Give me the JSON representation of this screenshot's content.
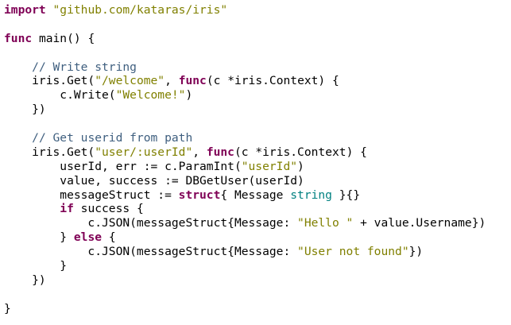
{
  "editor": {
    "colors": {
      "background": "#ffffff",
      "plain": "#000000",
      "keyword": "#7f0055",
      "string": "#808000",
      "comment": "#3f5f7f",
      "type": "#008080"
    },
    "lines": [
      [
        {
          "t": "kw",
          "v": "import"
        },
        {
          "t": "pln",
          "v": " "
        },
        {
          "t": "str",
          "v": "\"github.com/kataras/iris\""
        }
      ],
      [],
      [
        {
          "t": "kw",
          "v": "func"
        },
        {
          "t": "pln",
          "v": " main() {"
        }
      ],
      [],
      [
        {
          "t": "pln",
          "v": "    "
        },
        {
          "t": "cmt",
          "v": "// Write string"
        }
      ],
      [
        {
          "t": "pln",
          "v": "    iris.Get("
        },
        {
          "t": "str",
          "v": "\"/welcome\""
        },
        {
          "t": "pln",
          "v": ", "
        },
        {
          "t": "kw",
          "v": "func"
        },
        {
          "t": "pln",
          "v": "(c *iris.Context) {"
        }
      ],
      [
        {
          "t": "pln",
          "v": "        c.Write("
        },
        {
          "t": "str",
          "v": "\"Welcome!\""
        },
        {
          "t": "pln",
          "v": ")"
        }
      ],
      [
        {
          "t": "pln",
          "v": "    })"
        }
      ],
      [],
      [
        {
          "t": "pln",
          "v": "    "
        },
        {
          "t": "cmt",
          "v": "// Get userid from path"
        }
      ],
      [
        {
          "t": "pln",
          "v": "    iris.Get("
        },
        {
          "t": "str",
          "v": "\"user/:userId\""
        },
        {
          "t": "pln",
          "v": ", "
        },
        {
          "t": "kw",
          "v": "func"
        },
        {
          "t": "pln",
          "v": "(c *iris.Context) {"
        }
      ],
      [
        {
          "t": "pln",
          "v": "        userId, err := c.ParamInt("
        },
        {
          "t": "str",
          "v": "\"userId\""
        },
        {
          "t": "pln",
          "v": ")"
        }
      ],
      [
        {
          "t": "pln",
          "v": "        value, success := DBGetUser(userId)"
        }
      ],
      [
        {
          "t": "pln",
          "v": "        messageStruct := "
        },
        {
          "t": "kw",
          "v": "struct"
        },
        {
          "t": "pln",
          "v": "{ Message "
        },
        {
          "t": "typ",
          "v": "string"
        },
        {
          "t": "pln",
          "v": " }{}"
        }
      ],
      [
        {
          "t": "pln",
          "v": "        "
        },
        {
          "t": "kw",
          "v": "if"
        },
        {
          "t": "pln",
          "v": " success {"
        }
      ],
      [
        {
          "t": "pln",
          "v": "            c.JSON(messageStruct{Message: "
        },
        {
          "t": "str",
          "v": "\"Hello \""
        },
        {
          "t": "pln",
          "v": " + value.Username})"
        }
      ],
      [
        {
          "t": "pln",
          "v": "        } "
        },
        {
          "t": "kw",
          "v": "else"
        },
        {
          "t": "pln",
          "v": " {"
        }
      ],
      [
        {
          "t": "pln",
          "v": "            c.JSON(messageStruct{Message: "
        },
        {
          "t": "str",
          "v": "\"User not found\""
        },
        {
          "t": "pln",
          "v": "})"
        }
      ],
      [
        {
          "t": "pln",
          "v": "        }"
        }
      ],
      [
        {
          "t": "pln",
          "v": "    })"
        }
      ],
      [],
      [
        {
          "t": "pln",
          "v": "}"
        }
      ]
    ]
  }
}
